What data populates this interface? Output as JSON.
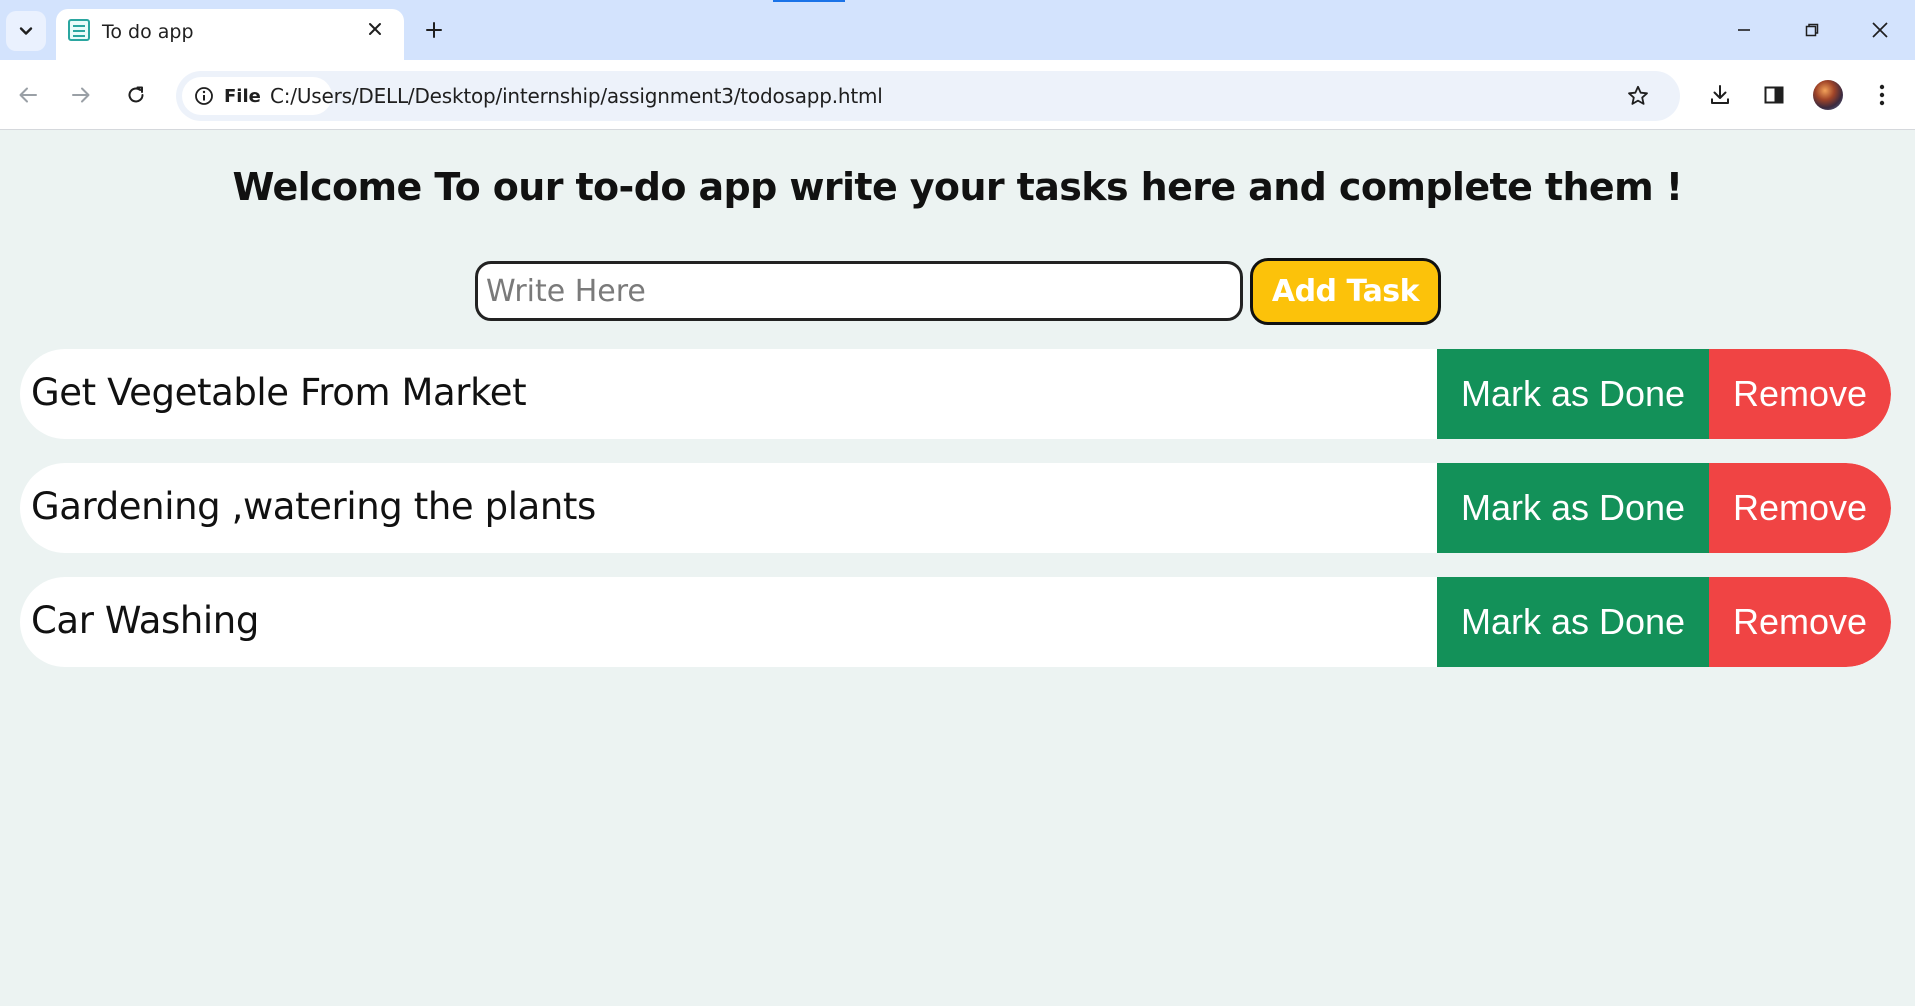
{
  "browser": {
    "tab_title": "To do app",
    "site_chip_label": "File",
    "url": "C:/Users/DELL/Desktop/internship/assignment3/todosapp.html"
  },
  "app": {
    "heading": "Welcome To our to-do app write your tasks here and complete them !",
    "input_placeholder": "Write Here",
    "input_value": "",
    "add_button_label": "Add Task",
    "done_button_label": "Mark as Done",
    "remove_button_label": "Remove",
    "tasks": [
      {
        "text": "Get Vegetable From Market"
      },
      {
        "text": "Gardening ,watering the plants"
      },
      {
        "text": "Car Washing"
      }
    ]
  },
  "colors": {
    "page_bg": "#ecf3f2",
    "add_button": "#fcc20a",
    "done_button": "#139159",
    "remove_button": "#f04444"
  }
}
